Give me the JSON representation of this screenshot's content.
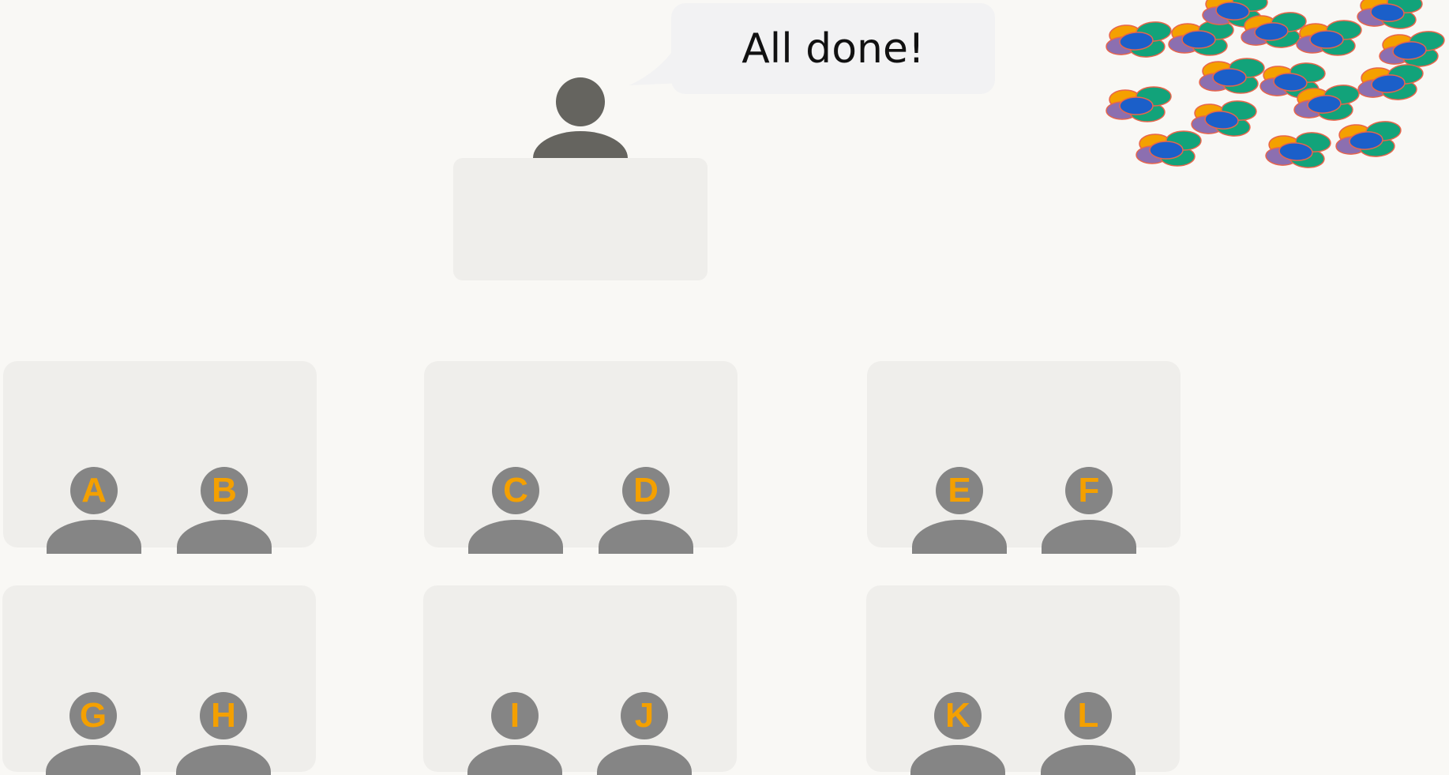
{
  "speech_bubble": {
    "text": "All done!"
  },
  "teacher": {
    "label": ""
  },
  "students": [
    "A",
    "B",
    "C",
    "D",
    "E",
    "F",
    "G",
    "H",
    "I",
    "J",
    "K",
    "L"
  ],
  "colors": {
    "background": "#f9f8f5",
    "desk": "#efeeeb",
    "student": "#858585",
    "student_letter": "#f4a000",
    "teacher": "#65645f",
    "bubble": "#f2f2f3"
  },
  "celebration": {
    "icon": "confetti-cluster-icon",
    "colors": [
      "#f4a000",
      "#8c6fb0",
      "#1b5fc9",
      "#12a37a",
      "#e8654c"
    ]
  }
}
